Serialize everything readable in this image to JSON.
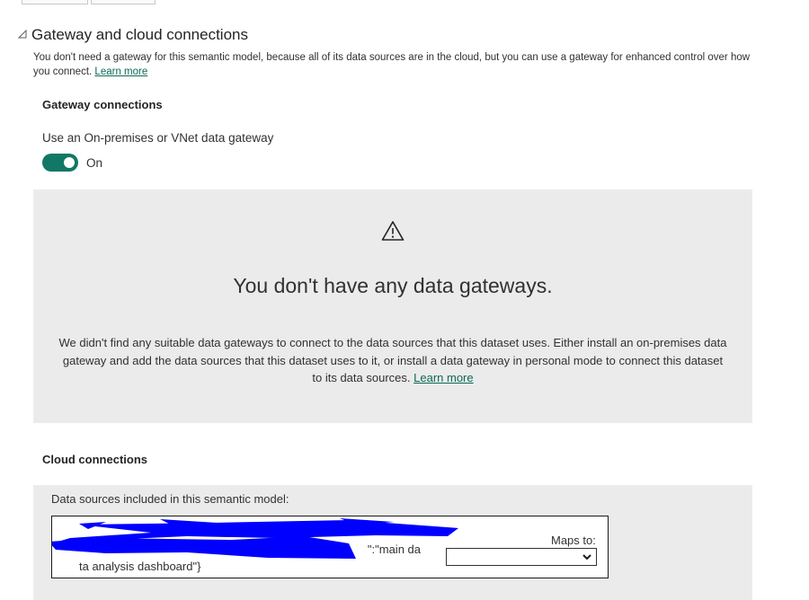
{
  "section": {
    "collapse_glyph": "◿",
    "title": "Gateway and cloud connections",
    "description": "You don't need a gateway for this semantic model, because all of its data sources are in the cloud, but you can use a gateway for enhanced control over how you connect.",
    "learn_more": "Learn more"
  },
  "gateway": {
    "heading": "Gateway connections",
    "toggle_label": "Use an On-premises or VNet data gateway",
    "toggle_state": "On",
    "toggle_on": true
  },
  "empty_state": {
    "icon": "warning-icon",
    "title": "You don't have any data gateways.",
    "description": "We didn't find any suitable data gateways to connect to the data sources that this dataset uses. Either install an on-premises data gateway and add the data sources that this dataset uses to it, or install a data gateway in personal mode to connect this dataset to its data sources.",
    "learn_more": "Learn more"
  },
  "cloud": {
    "heading": "Cloud connections",
    "caption": "Data sources included in this semantic model:",
    "data_source": {
      "name_line1": "\":\"main da",
      "name_line2": "ta analysis dashboard\"}",
      "maps_to_label": "Maps to:",
      "maps_to_value": ""
    }
  },
  "colors": {
    "accent": "#117865",
    "link": "#0b6a54",
    "panel": "#ebebeb",
    "redaction": "#0000ff"
  }
}
